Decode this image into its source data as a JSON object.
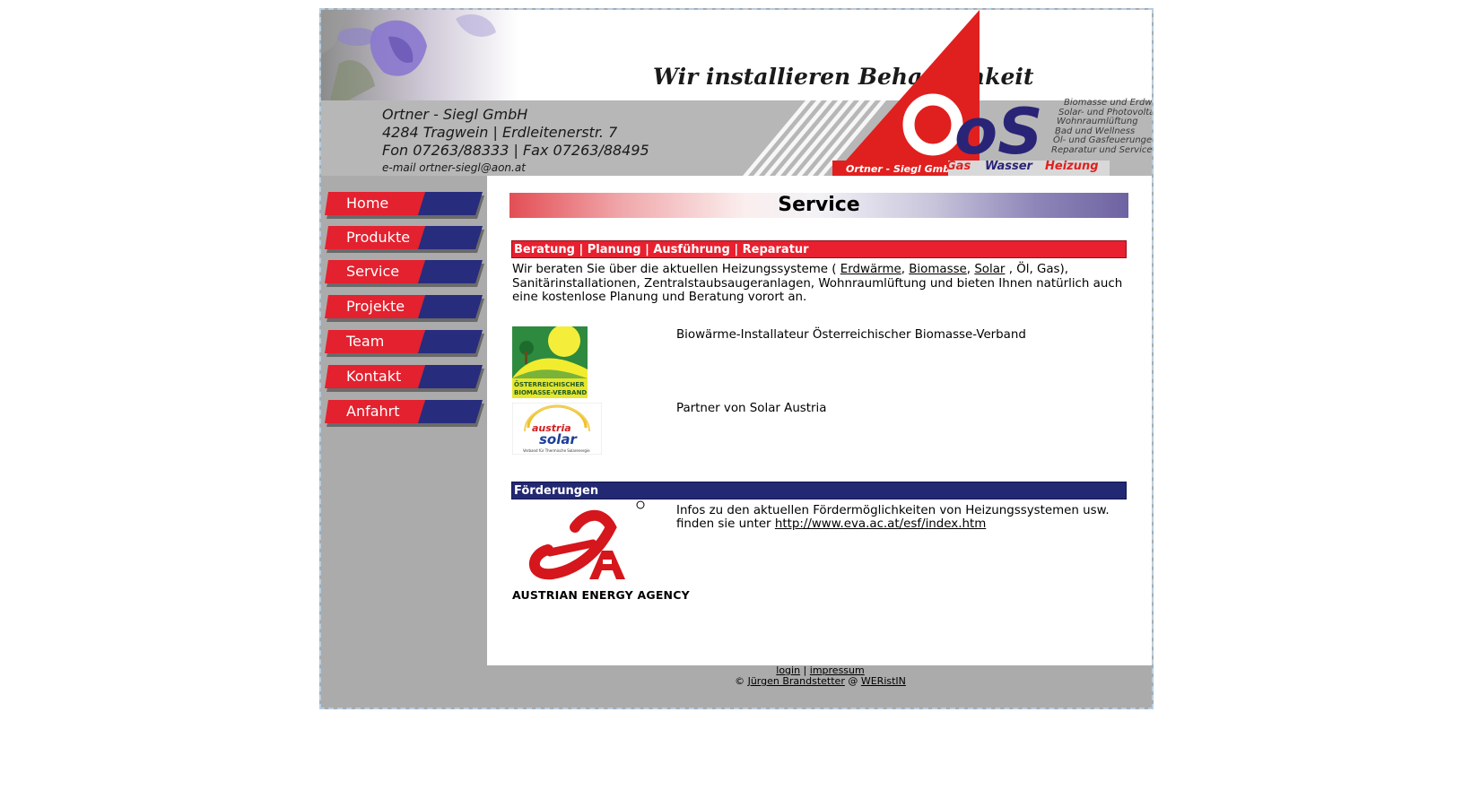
{
  "header": {
    "slogan": "Wir installieren Behaglichkeit",
    "company_name": "Ortner - Siegl GmbH",
    "address": "4284 Tragwein | Erdleitenerstr. 7",
    "phone_fax": "Fon 07263/88333 | Fax 07263/88495",
    "email_label": "e-mail  ortner-siegl@aon.at",
    "logo_letters": "oS",
    "logo_company": "Ortner - Siegl GmbH",
    "services": [
      "Biomasse und Erdwärme",
      "Solar- und Photovoltaik",
      "Wohnraumlüftung",
      "Bad und Wellness",
      "Öl- und Gasfeuerungen",
      "Reparatur und Service"
    ],
    "brand_gas": "Gas",
    "brand_wasser": "Wasser",
    "brand_heizung": "Heizung"
  },
  "nav": {
    "items": [
      {
        "label": "Home"
      },
      {
        "label": "Produkte"
      },
      {
        "label": "Service"
      },
      {
        "label": "Projekte"
      },
      {
        "label": "Team"
      },
      {
        "label": "Kontakt"
      },
      {
        "label": "Anfahrt"
      }
    ]
  },
  "main": {
    "title": "Service",
    "section1_heading": "Beratung | Planung | Ausführung | Reparatur",
    "intro_line1_pre": "Wir beraten Sie über die aktuellen Heizungssysteme ( ",
    "link_erdwaerme": "Erdwärme",
    "sep1": ", ",
    "link_biomasse": "Biomasse",
    "sep2": ", ",
    "link_solar": "Solar",
    "intro_line1_post": " , Öl, Gas),",
    "intro_line2": "Sanitärinstallationen, Zentralstaubsaugeranlagen, Wohnraumlüftung und bieten Ihnen natürlich auch",
    "intro_line3": "eine kostenlose Planung und Beratung vorort an.",
    "biomasse_logo_text1": "ÖSTERREICHISCHER",
    "biomasse_logo_text2": "BIOMASSE-VERBAND",
    "biomasse_text": "Biowärme-Installateur Österreichischer Biomasse-Verband",
    "solar_logo_text1": "austria",
    "solar_logo_text2": "solar",
    "solar_logo_sub": "Verband für Thermische Solarenergie",
    "solar_text": "Partner von Solar Austria",
    "section2_heading": "Förderungen",
    "eva_caption": "AUSTRIAN ENERGY AGENCY",
    "foerder_line1": "Infos zu den aktuellen Fördermöglichkeiten von Heizungssystemen usw.",
    "foerder_line2_pre": "finden sie unter ",
    "foerder_link": "http://www.eva.ac.at/esf/index.htm"
  },
  "footer": {
    "login": "login",
    "sep": " | ",
    "impressum": "impressum",
    "copyright_pre": "© ",
    "author": "Jürgen Brandstetter",
    "at": " @ ",
    "site": "WERistIN"
  },
  "colors": {
    "red": "#e8202f",
    "navy": "#232873",
    "gray": "#ababab"
  }
}
